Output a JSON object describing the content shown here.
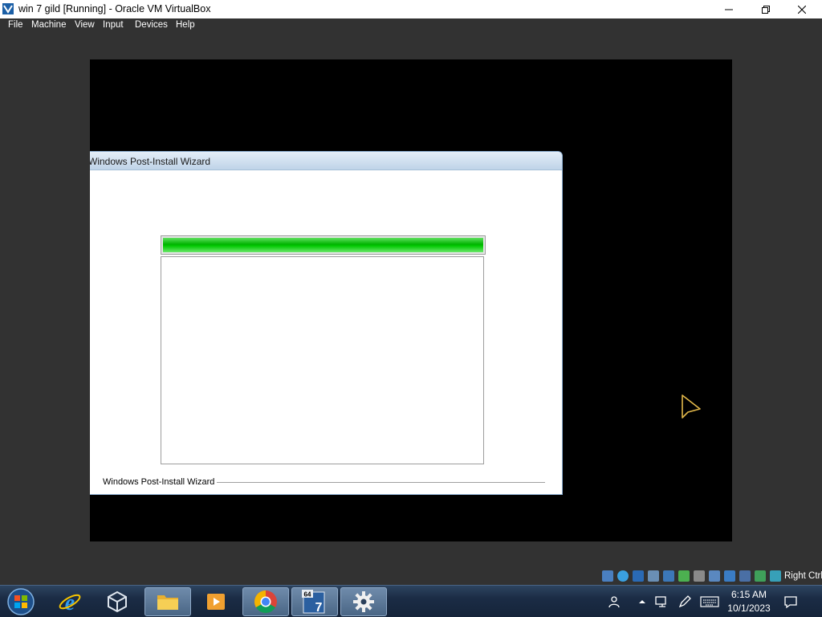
{
  "window": {
    "title": "win 7 gild [Running] - Oracle VM VirtualBox",
    "icon": "virtualbox-icon"
  },
  "menu": {
    "items": [
      "File",
      "Machine",
      "View",
      "Input",
      "Devices",
      "Help"
    ]
  },
  "wizard": {
    "title": "Windows Post-Install Wizard",
    "progress_percent": 100,
    "progress_color": "#00c000",
    "footer_label": "Windows Post-Install Wizard"
  },
  "statusbar": {
    "host_key": "Right Ctrl",
    "icons": [
      "hard-disk-icon",
      "optical-drive-icon",
      "floppy-icon",
      "audio-icon",
      "network-icon",
      "usb-icon",
      "shared-folders-icon",
      "display-icon",
      "recording-icon",
      "cpu-icon",
      "mouse-integration-icon",
      "keyboard-icon"
    ]
  },
  "taskbar": {
    "pinned": [
      "internet-explorer-icon",
      "virtualbox-icon",
      "file-explorer-icon",
      "media-player-icon",
      "chrome-icon",
      "win7-installer-icon",
      "settings-gear-icon"
    ],
    "installer_badge": "64",
    "installer_number": "7",
    "clock": {
      "time": "6:15 AM",
      "date": "10/1/2023"
    }
  }
}
